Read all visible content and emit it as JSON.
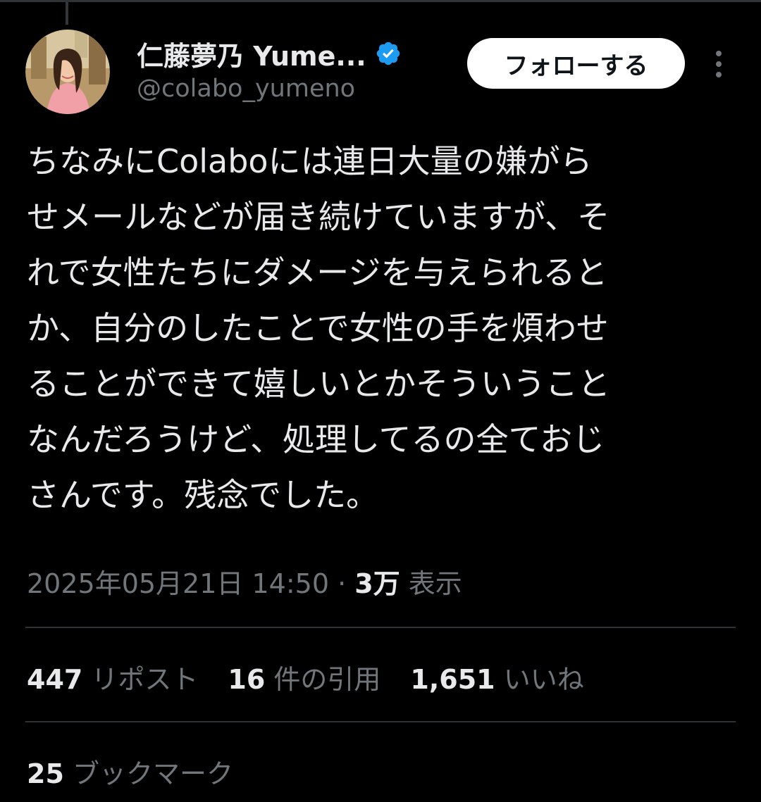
{
  "author": {
    "display_name": "仁藤夢乃 Yume...",
    "handle": "@colabo_yumeno",
    "verified": true,
    "verified_color": "#1d9bf0"
  },
  "follow_button_label": "フォローする",
  "tweet": {
    "text": "ちなみにColaboには連日大量の嫌がら\nせメールなどが届き続けていますが、そ\nれで女性たちにダメージを与えられると\nか、自分のしたことで女性の手を煩わせ\nることができて嬉しいとかそういうこと\nなんだろうけど、処理してるの全ておじ\nさんです。残念でした。"
  },
  "meta": {
    "datetime": "2025年05月21日 14:50",
    "separator": " · ",
    "views_count": "3万",
    "views_label": " 表示"
  },
  "stats": {
    "reposts": {
      "count": "447",
      "label": " リポスト"
    },
    "quotes": {
      "count": "16",
      "label": " 件の引用"
    },
    "likes": {
      "count": "1,651",
      "label": " いいね"
    },
    "bookmarks": {
      "count": "25",
      "label": " ブックマーク"
    }
  },
  "colors": {
    "background": "#000000",
    "primary_text": "#e7e9ea",
    "secondary_text": "#71767b",
    "divider": "#2f3336"
  }
}
